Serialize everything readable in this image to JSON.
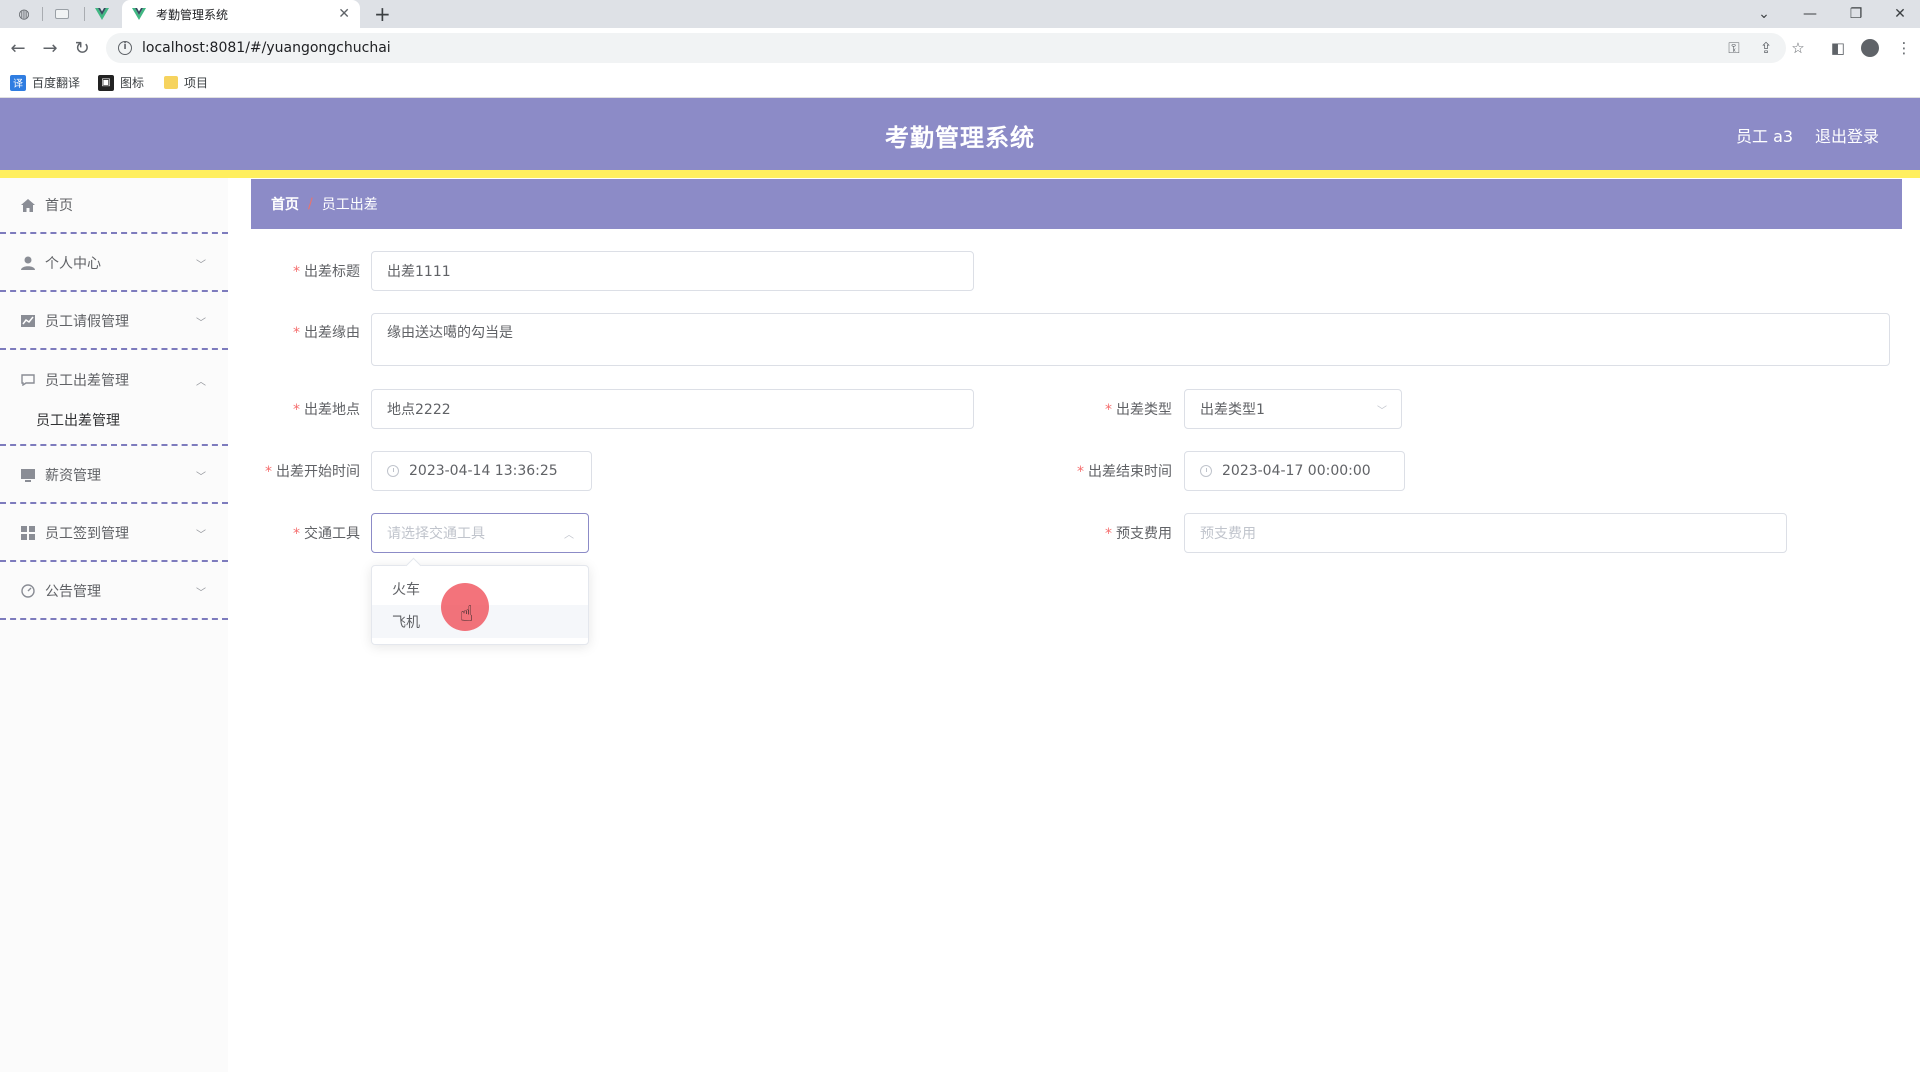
{
  "browser": {
    "tab_title": "考勤管理系统",
    "url": "localhost:8081/#/yuangongchuchai",
    "bookmarks": [
      "百度翻译",
      "图标",
      "项目"
    ]
  },
  "header": {
    "title": "考勤管理系统",
    "user": "员工 a3",
    "logout": "退出登录"
  },
  "sidebar": {
    "items": [
      {
        "label": "首页",
        "icon": "home-icon"
      },
      {
        "label": "个人中心",
        "icon": "user-icon"
      },
      {
        "label": "员工请假管理",
        "icon": "chart-icon"
      },
      {
        "label": "员工出差管理",
        "icon": "chat-icon"
      },
      {
        "label": "薪资管理",
        "icon": "monitor-icon"
      },
      {
        "label": "员工签到管理",
        "icon": "grid-icon"
      },
      {
        "label": "公告管理",
        "icon": "dashboard-icon"
      }
    ],
    "submenu": "员工出差管理"
  },
  "breadcrumb": {
    "home": "首页",
    "separator": "/",
    "current": "员工出差"
  },
  "form": {
    "title_label": "出差标题",
    "title_value": "出差1111",
    "reason_label": "出差缘由",
    "reason_value": "缘由送达噶的勾当是",
    "location_label": "出差地点",
    "location_value": "地点2222",
    "type_label": "出差类型",
    "type_value": "出差类型1",
    "start_label": "出差开始时间",
    "start_value": "2023-04-14 13:36:25",
    "end_label": "出差结束时间",
    "end_value": "2023-04-17 00:00:00",
    "transport_label": "交通工具",
    "transport_placeholder": "请选择交通工具",
    "budget_label": "预支费用",
    "budget_placeholder": "预支费用",
    "required_mark": "*"
  },
  "dropdown": {
    "options": [
      "火车",
      "飞机"
    ],
    "hovered": "飞机"
  },
  "colors": {
    "header_bg": "#8c8bc7",
    "accent_bar": "#ffef5f",
    "required": "#f56c6c"
  }
}
